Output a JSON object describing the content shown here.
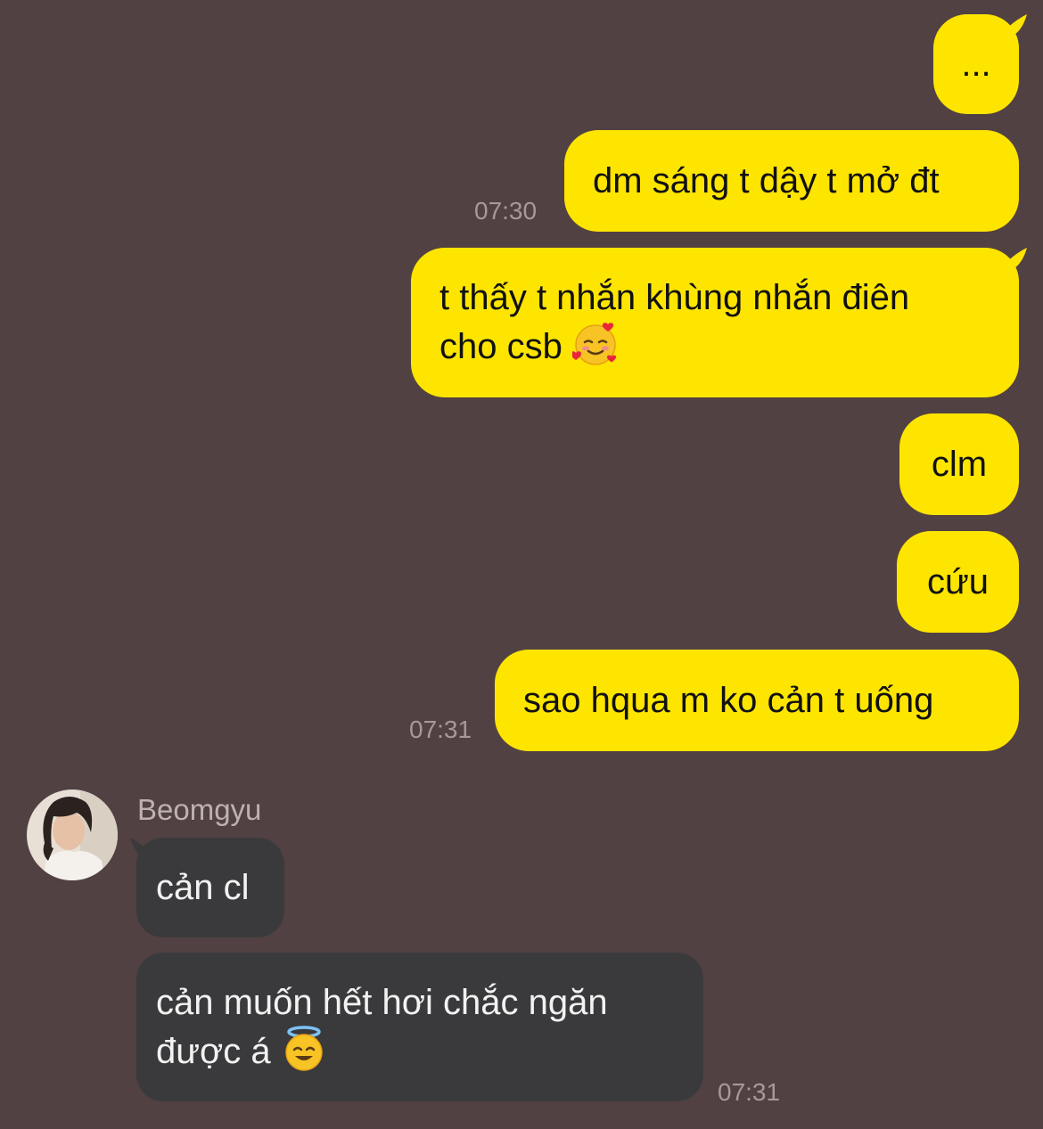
{
  "chat": {
    "messages": [
      {
        "from": "me",
        "text": "..."
      },
      {
        "from": "me",
        "text": "dm sáng t dậy t mở đt",
        "time": "07:30"
      },
      {
        "from": "me",
        "lines": [
          "t thấy t nhắn khùng nhắn điên",
          "cho csb"
        ],
        "emoji": "smiling-face-with-hearts"
      },
      {
        "from": "me",
        "text": "clm"
      },
      {
        "from": "me",
        "text": "cứu"
      },
      {
        "from": "me",
        "text": "sao hqua m ko cản t uống",
        "time": "07:31"
      },
      {
        "from": "Beomgyu",
        "sender_name": "Beomgyu",
        "text": "cản cl"
      },
      {
        "from": "Beomgyu",
        "lines": [
          "cản muốn hết hơi chắc ngăn",
          "được á"
        ],
        "emoji": "smiling-face-with-halo",
        "time": "07:31"
      }
    ]
  },
  "colors": {
    "background": "#524142",
    "sent_bubble": "#fee500",
    "received_bubble": "#3a3a3c"
  }
}
